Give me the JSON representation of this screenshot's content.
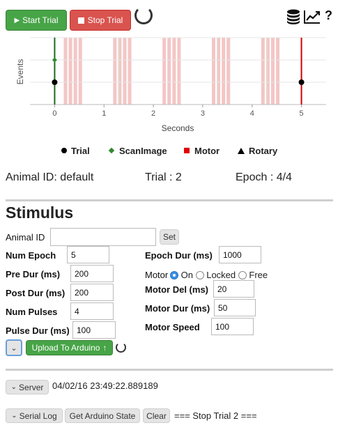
{
  "toolbar": {
    "start_label": "Start Trial",
    "stop_label": "Stop Trial",
    "help_label": "?"
  },
  "chart_data": {
    "type": "scatter",
    "xlabel": "Seconds",
    "ylabel": "Events",
    "xlim": [
      -0.5,
      5.5
    ],
    "x_ticks": [
      "0",
      "1",
      "2",
      "3",
      "4",
      "5"
    ],
    "grid": true,
    "legend_position": "bottom",
    "series": [
      {
        "name": "Trial",
        "color": "#000000",
        "marker": "circle",
        "points": [
          {
            "x": 0,
            "y": 1
          },
          {
            "x": 5,
            "y": 1
          }
        ]
      },
      {
        "name": "ScanImage",
        "color": "#2e8b2e",
        "marker": "diamond",
        "points": [
          {
            "x": 0,
            "y": 2
          }
        ]
      },
      {
        "name": "Motor",
        "color": "#e00000",
        "marker": "square",
        "points": []
      },
      {
        "name": "Rotary",
        "color": "#000000",
        "marker": "triangle",
        "points": []
      }
    ],
    "trial_start_line": 0,
    "trial_stop_line": 5,
    "pulse_bands": [
      0.22,
      0.32,
      0.42,
      0.52,
      1.22,
      1.32,
      1.42,
      1.52,
      2.22,
      2.32,
      2.42,
      2.52,
      3.22,
      3.32,
      3.42,
      3.52,
      4.22,
      4.32,
      4.42,
      4.52
    ],
    "epoch_lines": [
      1.3,
      3.3,
      4.3
    ]
  },
  "status": {
    "animal_id": "Animal ID: default",
    "trial": "Trial : 2",
    "epoch": "Epoch : 4/4"
  },
  "stimulus": {
    "heading": "Stimulus",
    "animal_id_label": "Animal ID",
    "animal_id_value": "",
    "set_label": "Set",
    "num_epoch_label": "Num Epoch",
    "num_epoch_value": "5",
    "pre_dur_label": "Pre Dur (ms)",
    "pre_dur_value": "200",
    "post_dur_label": "Post Dur (ms)",
    "post_dur_value": "200",
    "num_pulses_label": "Num Pulses",
    "num_pulses_value": "4",
    "pulse_dur_label": "Pulse Dur (ms)",
    "pulse_dur_value": "100",
    "epoch_dur_label": "Epoch Dur (ms)",
    "epoch_dur_value": "1000",
    "motor_label": "Motor",
    "motor_options": [
      "On",
      "Locked",
      "Free"
    ],
    "motor_selected": "On",
    "motor_del_label": "Motor Del (ms)",
    "motor_del_value": "20",
    "motor_dur_label": "Motor Dur (ms)",
    "motor_dur_value": "50",
    "motor_speed_label": "Motor Speed",
    "motor_speed_value": "100",
    "upload_label": "Upload To Arduino"
  },
  "server": {
    "button_label": "Server",
    "timestamp": "04/02/16 23:49:22.889189"
  },
  "log": {
    "serial_log_label": "Serial Log",
    "get_state_label": "Get Arduino State",
    "clear_label": "Clear",
    "message": "=== Stop Trial 2 ==="
  }
}
